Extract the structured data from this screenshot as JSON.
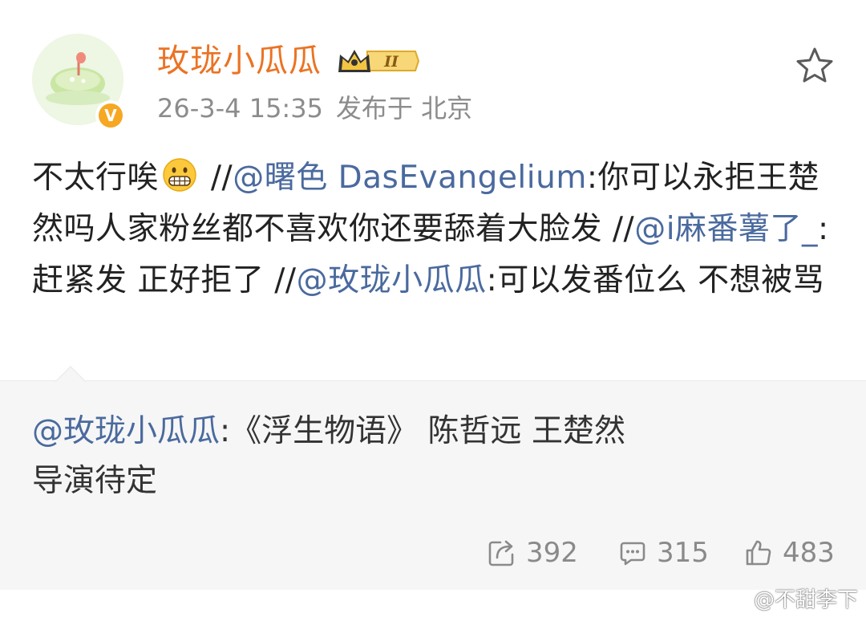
{
  "user": {
    "name": "玫珑小瓜瓜",
    "vip_level": "II",
    "verified_mark": "V",
    "avatar_icon": "melon-avatar-icon"
  },
  "meta": {
    "timestamp": "26-3-4 15:35",
    "location_label": "发布于 北京"
  },
  "post": {
    "text_1": "不太行唉",
    "sep_1": " //",
    "mention_1": "@曙色 DasEvangelium",
    "text_2": ":你可以永拒王楚然吗人家粉丝都不喜欢你还要舔着大脸发 //",
    "mention_2": "@i麻番薯了_",
    "text_3": ":赶紧发 正好拒了 //",
    "mention_3": "@玫珑小瓜瓜",
    "text_4": ":可以发番位么 不想被骂"
  },
  "quoted": {
    "mention": "@玫珑小瓜瓜",
    "text": ":《浮生物语》 陈哲远 王楚然",
    "text_2": "导演待定"
  },
  "actions": {
    "repost_count": "392",
    "comment_count": "315",
    "like_count": "483"
  },
  "watermark": {
    "text": "@不甜李下"
  },
  "colors": {
    "username": "#eb7323",
    "mention": "#4a6a9e",
    "meta": "#8c8c8c",
    "quote_bg": "#f6f6f6"
  }
}
